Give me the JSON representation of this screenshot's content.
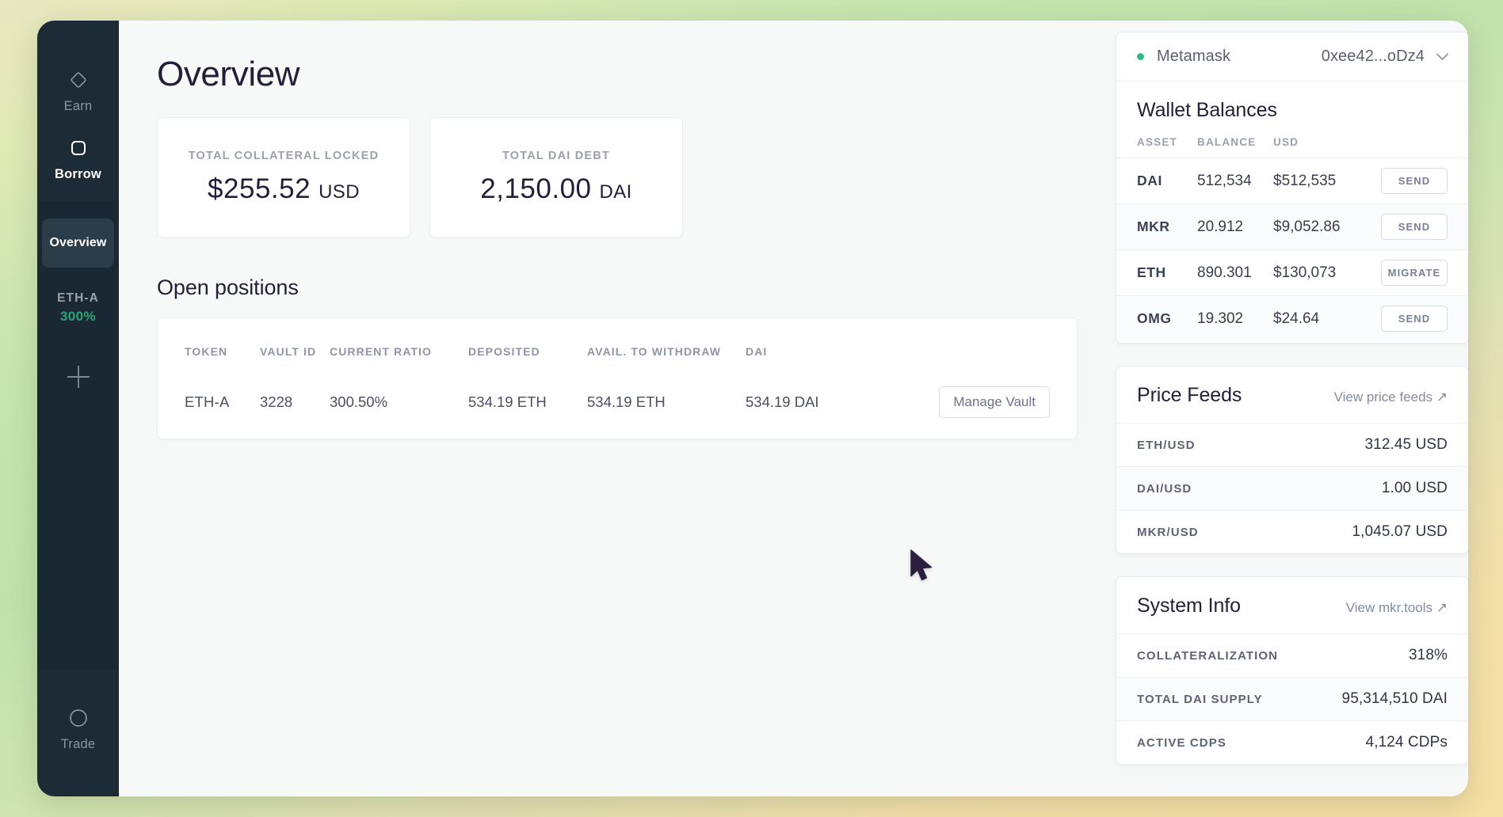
{
  "sidebar": {
    "top_items": [
      {
        "label": "Earn",
        "icon": "diamond-icon",
        "active": false
      },
      {
        "label": "Borrow",
        "icon": "rounded-square-icon",
        "active": true
      }
    ],
    "overview_label": "Overview",
    "vault": {
      "name": "ETH-A",
      "ratio": "300%"
    },
    "add_label": "+",
    "bottom_items": [
      {
        "label": "Trade",
        "icon": "circle-icon"
      }
    ]
  },
  "main": {
    "title": "Overview",
    "stats": [
      {
        "label": "TOTAL COLLATERAL LOCKED",
        "value": "$255.52",
        "unit": "USD"
      },
      {
        "label": "TOTAL DAI DEBT",
        "value": "2,150.00",
        "unit": "DAI"
      }
    ],
    "positions": {
      "heading": "Open positions",
      "columns": [
        "TOKEN",
        "VAULT ID",
        "CURRENT RATIO",
        "DEPOSITED",
        "AVAIL. TO WITHDRAW",
        "DAI",
        ""
      ],
      "rows": [
        {
          "token": "ETH-A",
          "vault_id": "3228",
          "current_ratio": "300.50%",
          "deposited": "534.19 ETH",
          "avail_to_withdraw": "534.19 ETH",
          "dai": "534.19 DAI",
          "action": "Manage Vault"
        }
      ]
    }
  },
  "rail": {
    "wallet": {
      "provider": "Metamask",
      "address": "0xee42...oDz4",
      "status_color": "#35b88a",
      "title": "Wallet Balances",
      "columns": [
        "ASSET",
        "BALANCE",
        "USD"
      ],
      "rows": [
        {
          "asset": "DAI",
          "balance": "512,534",
          "usd": "$512,535",
          "action": "SEND"
        },
        {
          "asset": "MKR",
          "balance": "20.912",
          "usd": "$9,052.86",
          "action": "SEND"
        },
        {
          "asset": "ETH",
          "balance": "890.301",
          "usd": "$130,073",
          "action": "MIGRATE"
        },
        {
          "asset": "OMG",
          "balance": "19.302",
          "usd": "$24.64",
          "action": "SEND"
        }
      ]
    },
    "price_feeds": {
      "title": "Price Feeds",
      "link": "View price feeds ↗",
      "rows": [
        {
          "key": "ETH/USD",
          "value": "312.45 USD"
        },
        {
          "key": "DAI/USD",
          "value": "1.00 USD"
        },
        {
          "key": "MKR/USD",
          "value": "1,045.07 USD"
        }
      ]
    },
    "system_info": {
      "title": "System Info",
      "link": "View mkr.tools ↗",
      "rows": [
        {
          "key": "COLLATERALIZATION",
          "value": "318%"
        },
        {
          "key": "TOTAL DAI SUPPLY",
          "value": "95,314,510 DAI"
        },
        {
          "key": "ACTIVE CDPS",
          "value": "4,124 CDPs"
        }
      ]
    }
  },
  "colors": {
    "accent_green": "#2ea37a",
    "sidebar_bg": "#1d2b36",
    "text_dark": "#231f39"
  }
}
